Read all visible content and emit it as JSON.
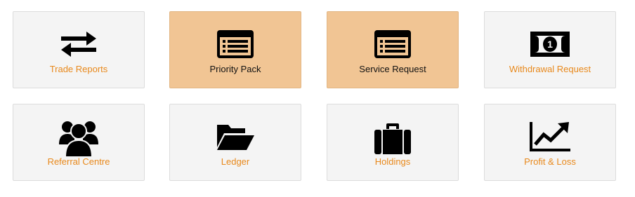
{
  "tiles": [
    {
      "label": "Trade Reports",
      "icon": "exchange-arrows-icon",
      "active": false
    },
    {
      "label": "Priority Pack",
      "icon": "list-window-icon",
      "active": true
    },
    {
      "label": "Service Request",
      "icon": "list-window-icon",
      "active": true
    },
    {
      "label": "Withdrawal Request",
      "icon": "money-bill-icon",
      "active": false
    },
    {
      "label": "Referral Centre",
      "icon": "users-group-icon",
      "active": false
    },
    {
      "label": "Ledger",
      "icon": "folder-open-icon",
      "active": false
    },
    {
      "label": "Holdings",
      "icon": "briefcase-icon",
      "active": false
    },
    {
      "label": "Profit & Loss",
      "icon": "line-chart-icon",
      "active": false
    }
  ],
  "colors": {
    "tile_bg": "#f4f4f4",
    "tile_active_bg": "#f1c594",
    "label_color": "#e8891c",
    "label_active_color": "#111111",
    "icon_color": "#000000"
  }
}
